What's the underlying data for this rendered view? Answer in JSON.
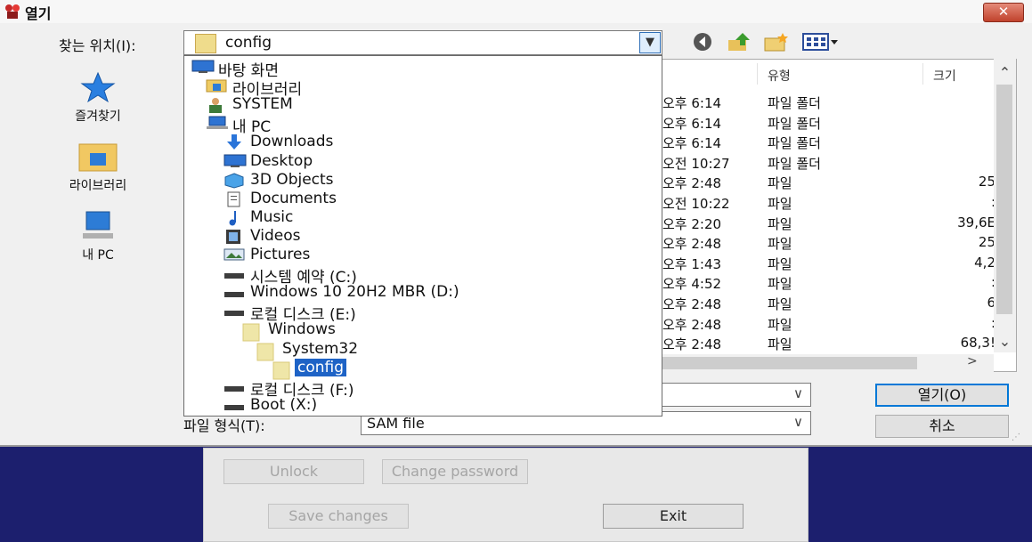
{
  "title_bar": {
    "title": "열기",
    "close_label": "✕"
  },
  "look_in": {
    "label": "찾는 위치(I):",
    "value": "config"
  },
  "toolbar": {
    "icons": [
      "back-icon",
      "up-folder-icon",
      "new-folder-icon",
      "view-menu-icon"
    ]
  },
  "places": [
    {
      "label": "즐겨찾기",
      "icon": "star-icon"
    },
    {
      "label": "라이브러리",
      "icon": "library-icon"
    },
    {
      "label": "내 PC",
      "icon": "pc-icon"
    }
  ],
  "list_headers": {
    "type": "유형",
    "size": "크기"
  },
  "file_rows": [
    {
      "date": "오후 6:14",
      "type": "파일 폴더",
      "size": ""
    },
    {
      "date": "오후 6:14",
      "type": "파일 폴더",
      "size": ""
    },
    {
      "date": "오후 6:14",
      "type": "파일 폴더",
      "size": ""
    },
    {
      "date": "오전 10:27",
      "type": "파일 폴더",
      "size": ""
    },
    {
      "date": "오후 2:48",
      "type": "파일",
      "size": "25"
    },
    {
      "date": "오전 10:22",
      "type": "파일",
      "size": ":"
    },
    {
      "date": "오후 2:20",
      "type": "파일",
      "size": "39,6E"
    },
    {
      "date": "오후 2:48",
      "type": "파일",
      "size": "25"
    },
    {
      "date": "오후 1:43",
      "type": "파일",
      "size": "4,2"
    },
    {
      "date": "오후 4:52",
      "type": "파일",
      "size": ":"
    },
    {
      "date": "오후 2:48",
      "type": "파일",
      "size": "6"
    },
    {
      "date": "오후 2:48",
      "type": "파일",
      "size": ":"
    },
    {
      "date": "오후 2:48",
      "type": "파일",
      "size": "68,3!"
    }
  ],
  "file_type": {
    "label": "파일 형식(T):",
    "value": "SAM file"
  },
  "buttons": {
    "open": "열기(O)",
    "cancel": "취소"
  },
  "dropdown_items": [
    {
      "label": "바탕 화면",
      "icon": "desktop-icon"
    },
    {
      "label": "라이브러리",
      "icon": "library-icon"
    },
    {
      "label": "SYSTEM",
      "icon": "user-icon"
    },
    {
      "label": "내 PC",
      "icon": "pc-icon"
    },
    {
      "label": "Downloads",
      "icon": "download-icon"
    },
    {
      "label": "Desktop",
      "icon": "desktop-icon"
    },
    {
      "label": "3D Objects",
      "icon": "cube-icon"
    },
    {
      "label": "Documents",
      "icon": "document-icon"
    },
    {
      "label": "Music",
      "icon": "music-icon"
    },
    {
      "label": "Videos",
      "icon": "video-icon"
    },
    {
      "label": "Pictures",
      "icon": "picture-icon"
    },
    {
      "label": "시스템 예약 (C:)",
      "icon": "drive-icon"
    },
    {
      "label": "Windows 10 20H2 MBR (D:)",
      "icon": "drive-icon"
    },
    {
      "label": "로컬 디스크 (E:)",
      "icon": "drive-icon"
    },
    {
      "label": "Windows",
      "icon": "folder-icon"
    },
    {
      "label": "System32",
      "icon": "folder-icon"
    },
    {
      "label": "config",
      "icon": "folder-icon",
      "selected": true
    },
    {
      "label": "로컬 디스크 (F:)",
      "icon": "drive-icon"
    },
    {
      "label": "Boot (X:)",
      "icon": "drive-icon"
    }
  ],
  "background_app": {
    "buttons": {
      "unlock": "Unlock",
      "change_password": "Change password",
      "save_changes": "Save changes",
      "exit": "Exit"
    }
  }
}
